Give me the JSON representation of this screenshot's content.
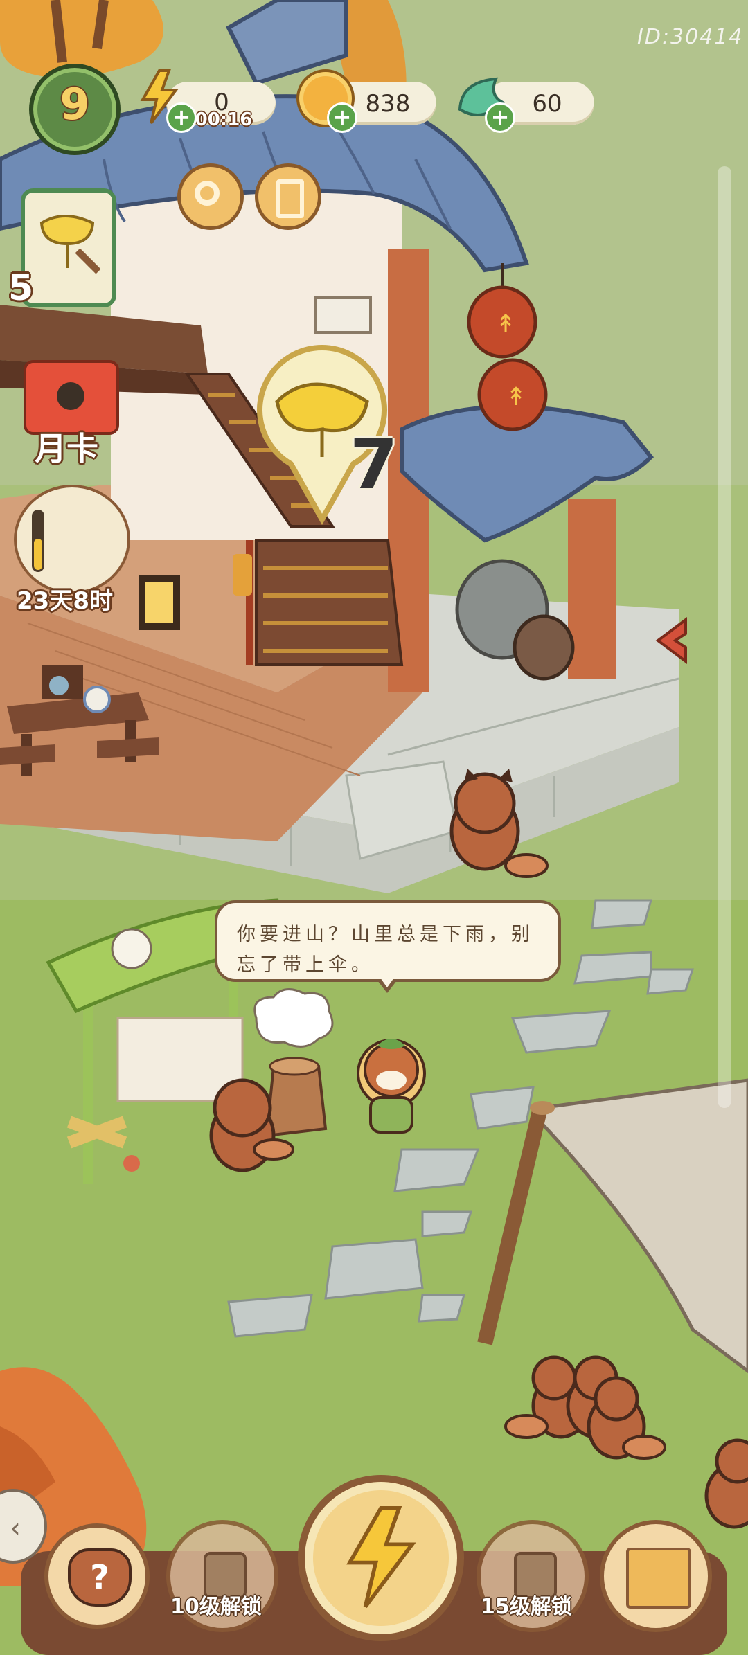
{
  "player": {
    "id_label": "ID:30414",
    "level": "9"
  },
  "resources": {
    "energy": {
      "value": "0",
      "timer": "00:16",
      "icon": "lightning-icon"
    },
    "coins": {
      "value": "838",
      "icon": "coin-icon"
    },
    "leaves": {
      "value": "60",
      "icon": "leaf-gem-icon"
    }
  },
  "side_menu": {
    "ginkgo_quest_count": "5",
    "monthly_card_label": "月卡",
    "event_timer": "23天8时"
  },
  "scene": {
    "ginkgo_marker_count": "7",
    "speech": "你要进山？山里总是下雨，别忘了带上伞。"
  },
  "bottom_bar": {
    "help_icon": "question-cat-icon",
    "lock1_label": "10级解锁",
    "center_icon": "lightning-icon",
    "lock2_label": "15级解锁",
    "map_icon": "paw-map-icon"
  },
  "colors": {
    "grass": "#9dbb62",
    "roof": "#6f8bb5",
    "wood": "#b9663e",
    "cream": "#f4efdc",
    "outline": "#6b3b1e"
  }
}
